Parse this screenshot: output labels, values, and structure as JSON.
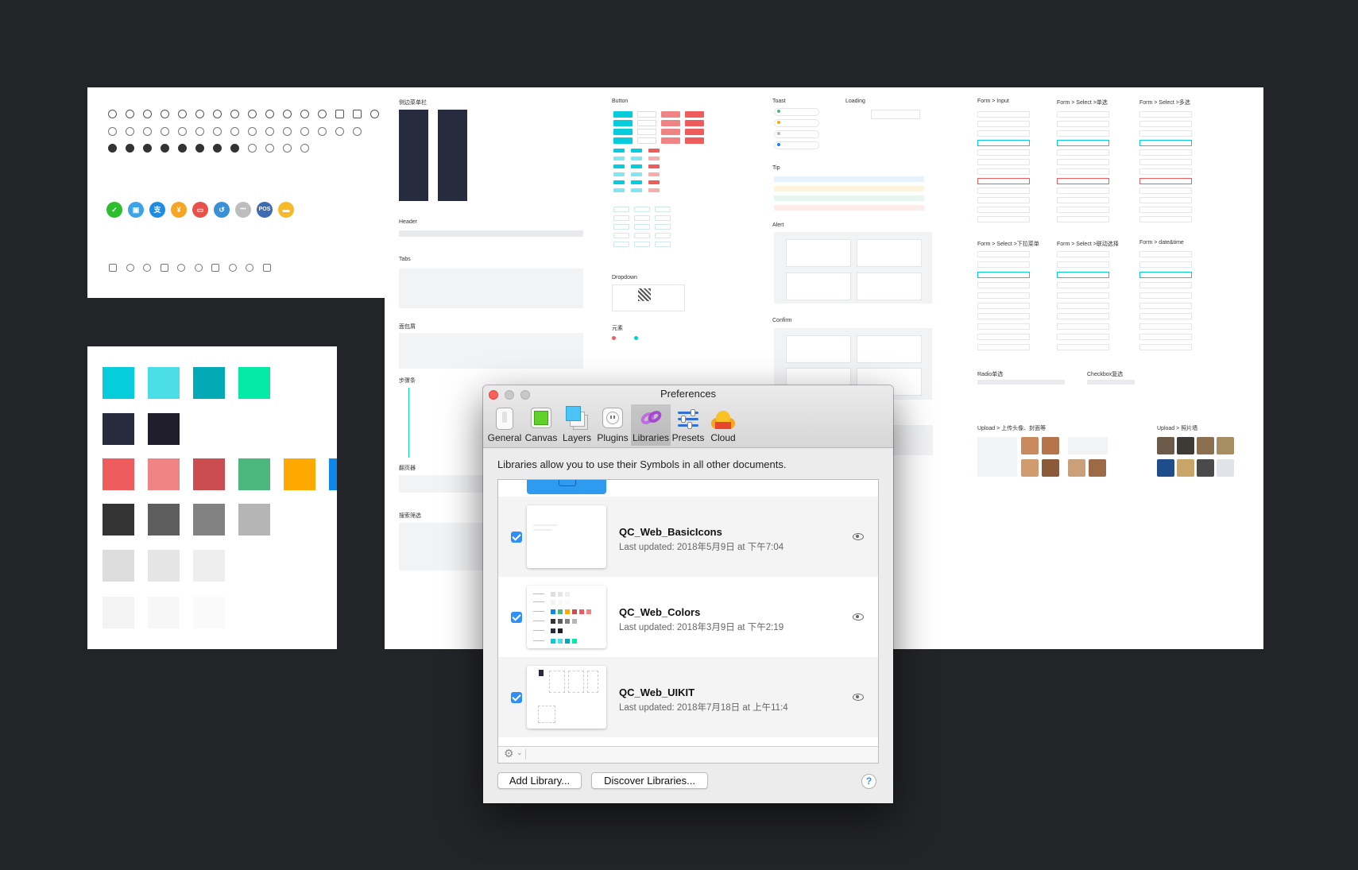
{
  "colors": {
    "primary": [
      "#07CCDB",
      "#4CDEE6",
      "#04A9B6",
      "#05EAA6"
    ],
    "dark": [
      "#262B3D",
      "#1F1E2A"
    ],
    "status": [
      "#EE5C5E",
      "#F08384",
      "#CC4D4F",
      "#4CB77C",
      "#FFA900",
      "#0D87EA"
    ],
    "grays": [
      "#333333",
      "#5D5D5D",
      "#828282",
      "#B5B5B5"
    ],
    "light": [
      "#DDDDDD",
      "#E5E5E5",
      "#EEEEEE"
    ],
    "lightest": [
      "#F3F3F3",
      "#F7F7F7",
      "#FAFAFA"
    ]
  },
  "payment_icons": [
    {
      "name": "wechat-pay-icon",
      "color": "#2DBE2E",
      "glyph": "✓"
    },
    {
      "name": "scan-pay-icon",
      "color": "#3CA3E8",
      "glyph": "▣"
    },
    {
      "name": "alipay-icon",
      "color": "#1E8CE3",
      "glyph": "支"
    },
    {
      "name": "cash-icon",
      "color": "#F6A622",
      "glyph": "¥"
    },
    {
      "name": "card-pay-icon",
      "color": "#E8514A",
      "glyph": "▭"
    },
    {
      "name": "refund-icon",
      "color": "#3A8FD6",
      "glyph": "↺"
    },
    {
      "name": "more-pay-icon",
      "color": "#BDBDBD",
      "glyph": "•••"
    },
    {
      "name": "pos-pay-icon",
      "color": "#3D6AB3",
      "glyph": "POS"
    },
    {
      "name": "voucher-icon",
      "color": "#F6B928",
      "glyph": "▬"
    }
  ],
  "ui_kit": {
    "sections": {
      "sidebar": "侧边菜单栏",
      "header": "Header",
      "tabs": "Tabs",
      "breadcrumb": "面包屑",
      "steps": "步骤条",
      "pagination": "翻页器",
      "search_filter": "搜索筛选",
      "button": "Button",
      "dropdown": "Dropdown",
      "element": "元素",
      "toast": "Toast",
      "loading": "Loading",
      "tip": "Tip",
      "alert": "Alert",
      "confirm": "Confirm",
      "form_input": "Form > Input",
      "form_select_single": "Form > Select >单选",
      "form_select_multi": "Form > Select >多选",
      "form_select_dropdown": "Form > Select >下拉菜单",
      "form_select_cascade": "Form > Select >联动选择",
      "form_datetime": "Form > date&time",
      "radio": "Radio单选",
      "checkbox": "Checkbox复选",
      "upload_avatar": "Upload > 上传头像、封面等",
      "upload_photo_wall": "Upload > 照片墙"
    }
  },
  "preferences": {
    "title": "Preferences",
    "toolbar": [
      "General",
      "Canvas",
      "Layers",
      "Plugins",
      "Libraries",
      "Presets",
      "Cloud"
    ],
    "selected_tab": "Libraries",
    "intro": "Libraries allow you to use their Symbols in all other documents.",
    "libraries": [
      {
        "name": "QC_Web_BasicIcons",
        "updated": "Last updated: 2018年5月9日 at 下午7:04",
        "enabled": true
      },
      {
        "name": "QC_Web_Colors",
        "updated": "Last updated: 2018年3月9日 at 下午2:19",
        "enabled": true
      },
      {
        "name": "QC_Web_UIKIT",
        "updated": "Last updated: 2018年7月18日 at 上午11:4",
        "enabled": true
      }
    ],
    "add_library": "Add Library...",
    "discover_libraries": "Discover Libraries...",
    "help": "?"
  }
}
